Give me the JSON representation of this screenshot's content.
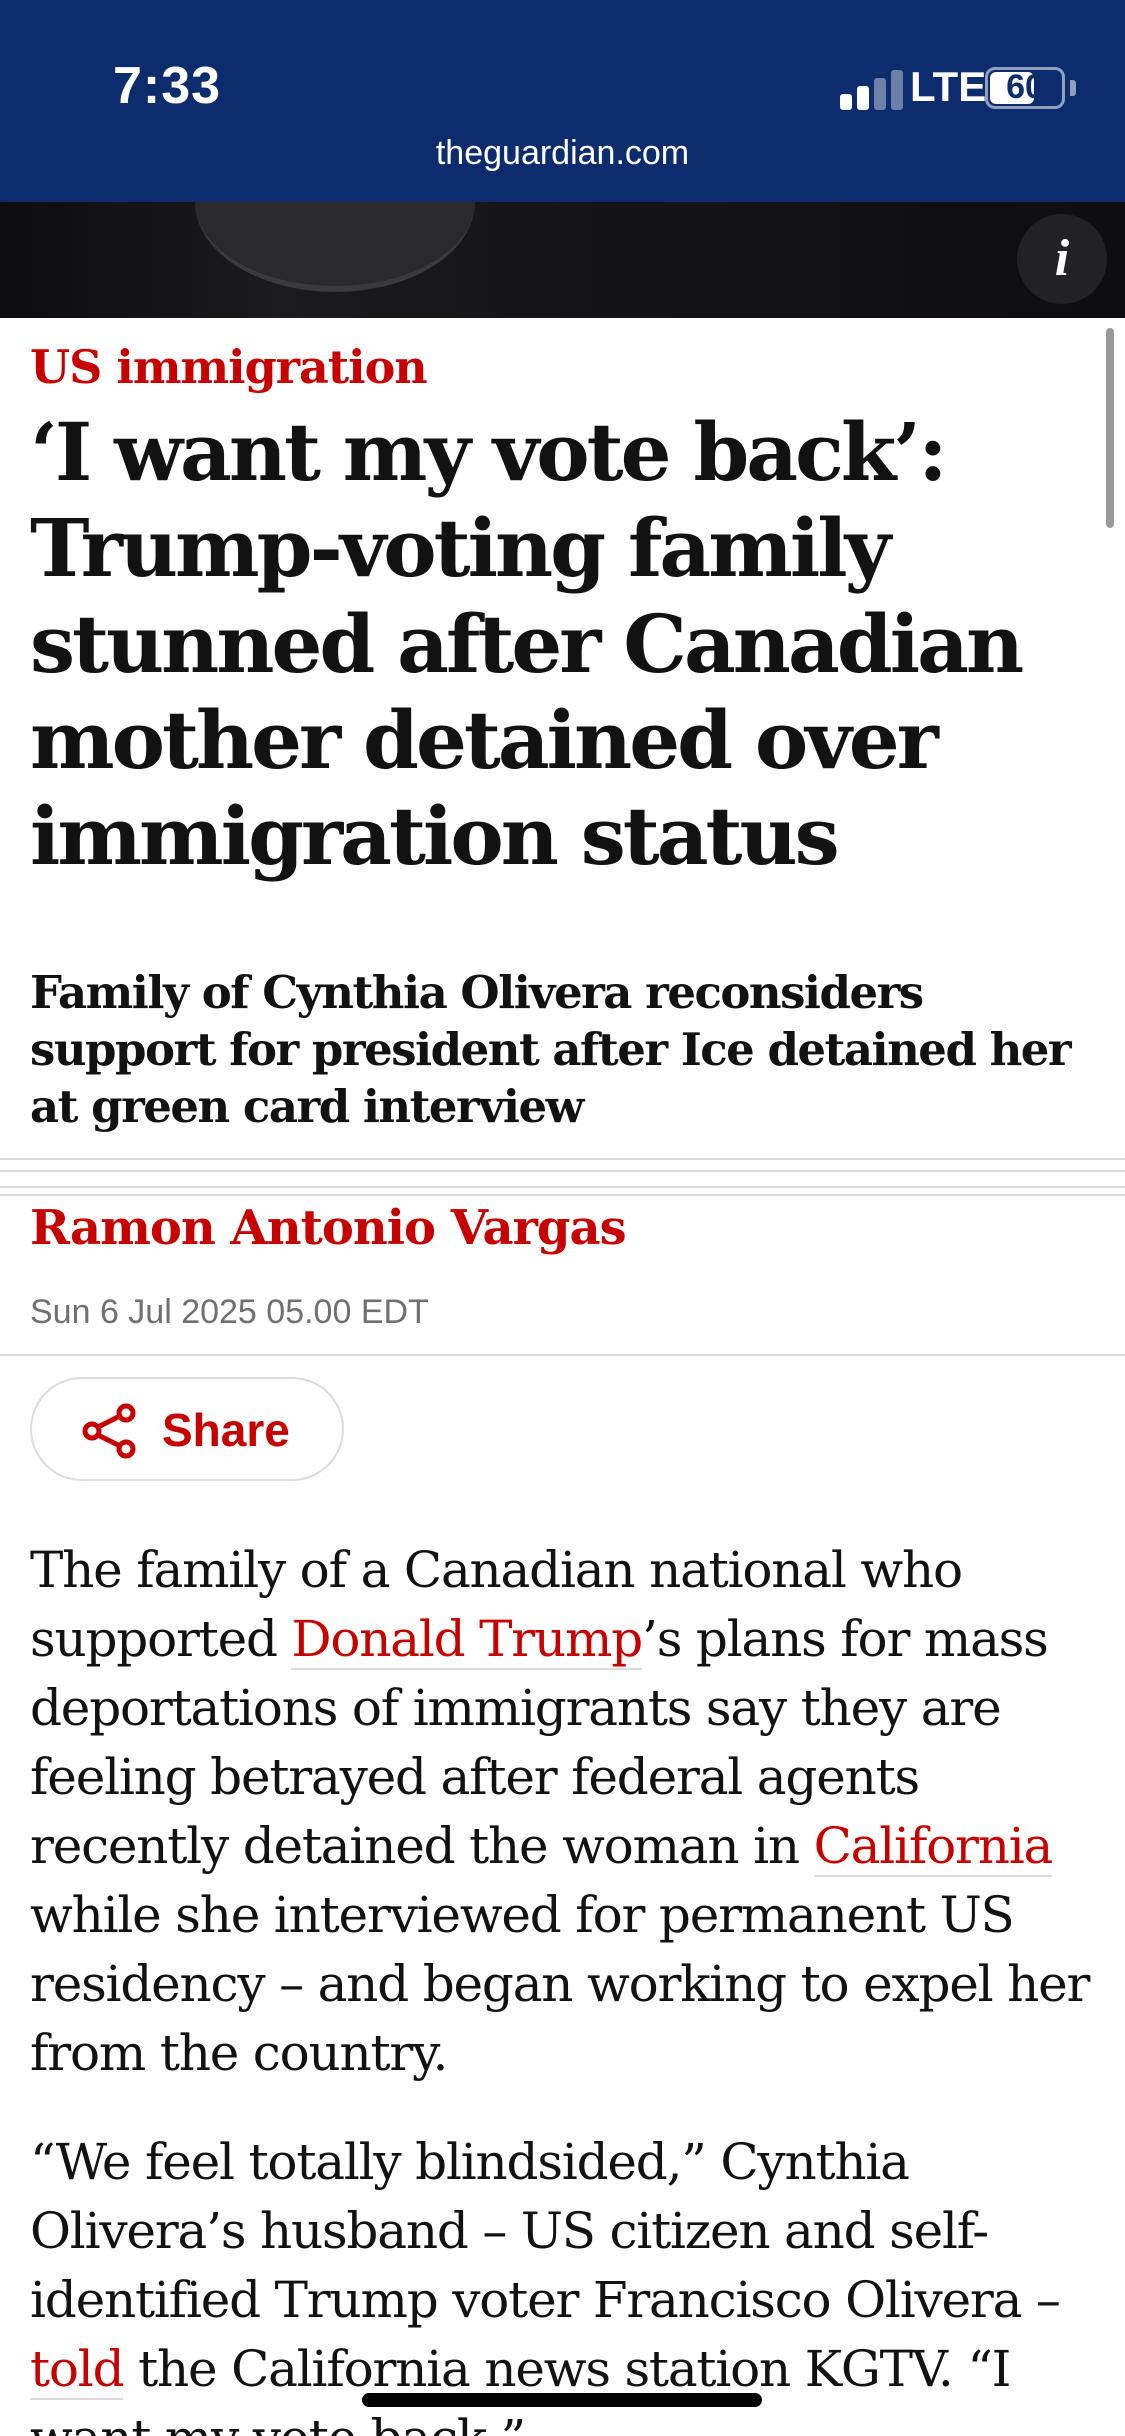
{
  "status_bar": {
    "time": "7:33",
    "network": "LTE",
    "battery_level": "60"
  },
  "browser": {
    "url": "theguardian.com"
  },
  "hero": {
    "info_label": "i"
  },
  "article": {
    "kicker": "US immigration",
    "headline": "‘I want my vote back’: Trump-voting family stunned after Canadian mother detained over immigration status",
    "standfirst": "Family of Cynthia Olivera reconsiders support for president after Ice detained her at green card interview",
    "byline": "Ramon Antonio Vargas",
    "date": "Sun 6 Jul 2025 05.00 EDT",
    "share_label": "Share",
    "paragraph1": {
      "part1": "The family of a Canadian national who supported ",
      "link1": "Donald Trump",
      "part2": "’s plans for mass deportations of immigrants say they are feeling betrayed after federal agents recently detained the woman in ",
      "link2": "California",
      "part3": " while she interviewed for permanent US residency – and began working to expel her from the country."
    },
    "paragraph2": {
      "part1": "“We feel totally blindsided,” Cynthia Olivera’s husband – US citizen and self-identified Trump voter Francisco Olivera – ",
      "link1": "told",
      "part2": " the California news station KGTV. “I want my vote back.”"
    }
  },
  "colors": {
    "guardian_red": "#c70000",
    "header_blue": "#0c2c6e",
    "text": "#121212"
  }
}
